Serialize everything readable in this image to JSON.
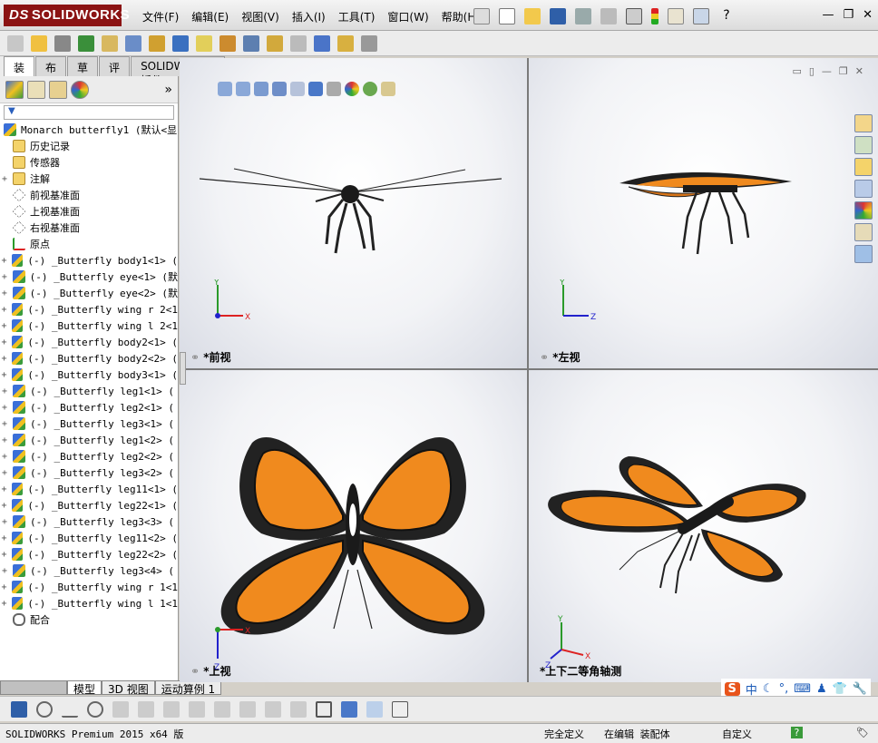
{
  "app": {
    "logo": "SOLIDWORKS",
    "logo_mark": "DS"
  },
  "menus": [
    "文件(F)",
    "编辑(E)",
    "视图(V)",
    "插入(I)",
    "工具(T)",
    "窗口(W)",
    "帮助(H)"
  ],
  "command_tabs": [
    "装配体",
    "布局",
    "草图",
    "评估",
    "SOLIDWORKS 插件"
  ],
  "tree": {
    "root": "Monarch butterfly1  (默认<显",
    "items": [
      {
        "label": "历史记录",
        "kind": "folder",
        "expand": ""
      },
      {
        "label": "传感器",
        "kind": "folder",
        "expand": ""
      },
      {
        "label": "注解",
        "kind": "folder",
        "expand": "+"
      },
      {
        "label": "前视基准面",
        "kind": "plane",
        "expand": ""
      },
      {
        "label": "上视基准面",
        "kind": "plane",
        "expand": ""
      },
      {
        "label": "右视基准面",
        "kind": "plane",
        "expand": ""
      },
      {
        "label": "原点",
        "kind": "origin",
        "expand": ""
      },
      {
        "label": "(-) _Butterfly body1<1> (",
        "kind": "part",
        "expand": "+"
      },
      {
        "label": "(-) _Butterfly eye<1> (默",
        "kind": "part",
        "expand": "+"
      },
      {
        "label": "(-) _Butterfly eye<2> (默",
        "kind": "part",
        "expand": "+"
      },
      {
        "label": "(-) _Butterfly wing r 2<1",
        "kind": "part",
        "expand": "+"
      },
      {
        "label": "(-) _Butterfly wing l 2<1",
        "kind": "part",
        "expand": "+"
      },
      {
        "label": "(-) _Butterfly body2<1> (",
        "kind": "part",
        "expand": "+"
      },
      {
        "label": "(-) _Butterfly body2<2> (",
        "kind": "part",
        "expand": "+"
      },
      {
        "label": "(-) _Butterfly body3<1> (",
        "kind": "part",
        "expand": "+"
      },
      {
        "label": "(-) _Butterfly leg1<1> (",
        "kind": "part",
        "expand": "+"
      },
      {
        "label": "(-) _Butterfly leg2<1> (",
        "kind": "part",
        "expand": "+"
      },
      {
        "label": "(-) _Butterfly leg3<1> (",
        "kind": "part",
        "expand": "+"
      },
      {
        "label": "(-) _Butterfly leg1<2> (",
        "kind": "part",
        "expand": "+"
      },
      {
        "label": "(-) _Butterfly leg2<2> (",
        "kind": "part",
        "expand": "+"
      },
      {
        "label": "(-) _Butterfly leg3<2> (",
        "kind": "part",
        "expand": "+"
      },
      {
        "label": "(-) _Butterfly leg11<1> (",
        "kind": "part",
        "expand": "+"
      },
      {
        "label": "(-) _Butterfly leg22<1> (",
        "kind": "part",
        "expand": "+"
      },
      {
        "label": "(-) _Butterfly leg3<3> (",
        "kind": "part",
        "expand": "+"
      },
      {
        "label": "(-) _Butterfly leg11<2> (",
        "kind": "part",
        "expand": "+"
      },
      {
        "label": "(-) _Butterfly leg22<2> (",
        "kind": "part",
        "expand": "+"
      },
      {
        "label": "(-) _Butterfly leg3<4> (",
        "kind": "part",
        "expand": "+"
      },
      {
        "label": "(-) _Butterfly wing r 1<1",
        "kind": "part",
        "expand": "+"
      },
      {
        "label": "(-) _Butterfly wing l 1<1",
        "kind": "part",
        "expand": "+"
      },
      {
        "label": "配合",
        "kind": "mate",
        "expand": ""
      }
    ]
  },
  "bottom_tabs": [
    "模型",
    "3D 视图",
    "运动算例 1"
  ],
  "viewports": {
    "front": "*前视",
    "left": "*左视",
    "top": "*上视",
    "iso": "*上下二等角轴测"
  },
  "triad_labels": {
    "x": "X",
    "y": "Y",
    "z": "Z"
  },
  "status": {
    "product": "SOLIDWORKS Premium 2015 x64 版",
    "definition": "完全定义",
    "editing": "在编辑 装配体",
    "units": "自定义",
    "help": "?"
  },
  "ime": {
    "mark": "S",
    "lang": "中"
  },
  "colors": {
    "wing_orange": "#f08a1e",
    "wing_black": "#202020",
    "logo_red": "#8b1313"
  }
}
